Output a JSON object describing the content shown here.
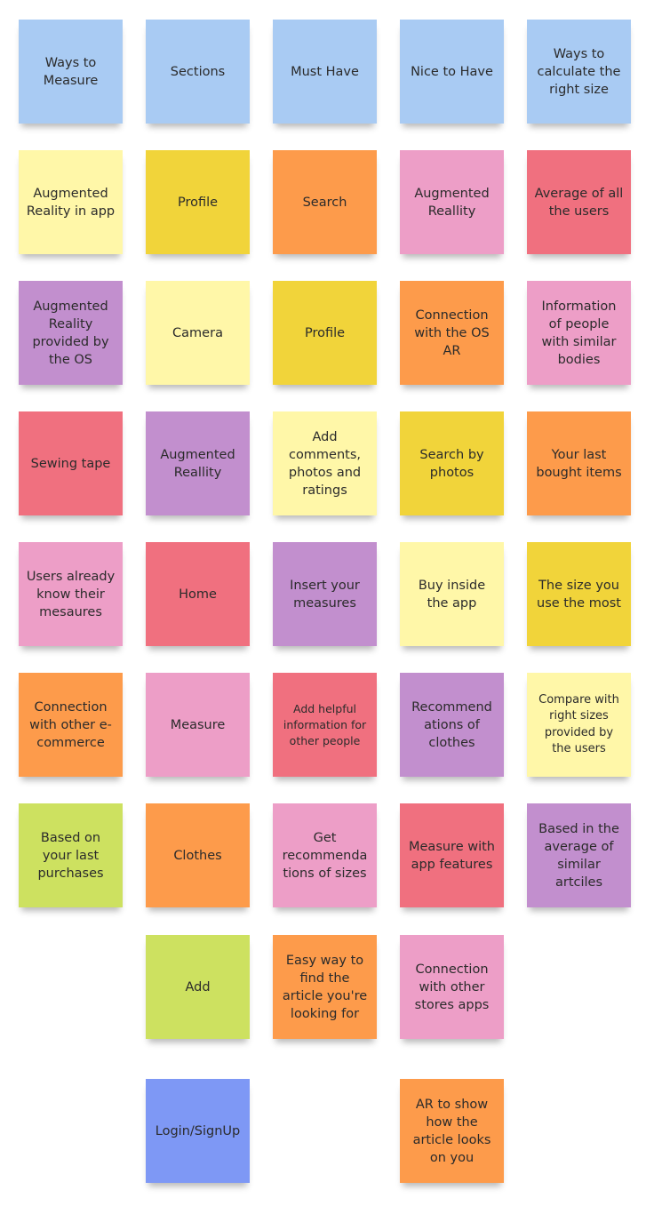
{
  "notes": [
    {
      "text": "Ways to\nMeasure",
      "color": "#a9cbf3"
    },
    {
      "text": "Sections",
      "color": "#a9cbf3"
    },
    {
      "text": "Must Have",
      "color": "#a9cbf3"
    },
    {
      "text": "Nice to Have",
      "color": "#a9cbf3"
    },
    {
      "text": "Ways to calculate the right size",
      "color": "#a9cbf3"
    },
    {
      "text": "Augmented Reality in app",
      "color": "#fff7a8"
    },
    {
      "text": "Profile",
      "color": "#f1d43a"
    },
    {
      "text": "Search",
      "color": "#fd9b4b"
    },
    {
      "text": "Augmented Reallity",
      "color": "#ed9ec7"
    },
    {
      "text": "Average of all the users",
      "color": "#f0707f"
    },
    {
      "text": "Augmented Reality provided by the OS",
      "color": "#c28fce"
    },
    {
      "text": "Camera",
      "color": "#fff7a8"
    },
    {
      "text": "Profile",
      "color": "#f1d43a"
    },
    {
      "text": "Connection with the OS AR",
      "color": "#fd9b4b"
    },
    {
      "text": "Information of people with similar bodies",
      "color": "#ed9ec7"
    },
    {
      "text": "Sewing tape",
      "color": "#f0707f"
    },
    {
      "text": "Augmented Reallity",
      "color": "#c28fce"
    },
    {
      "text": "Add comments, photos and ratings",
      "color": "#fff7a8"
    },
    {
      "text": "Search by photos",
      "color": "#f1d43a"
    },
    {
      "text": "Your last bought items",
      "color": "#fd9b4b"
    },
    {
      "text": "Users already know their mesaures",
      "color": "#ed9ec7"
    },
    {
      "text": "Home",
      "color": "#f0707f"
    },
    {
      "text": "Insert your measures",
      "color": "#c28fce"
    },
    {
      "text": "Buy inside the app",
      "color": "#fff7a8"
    },
    {
      "text": "The size you use the most",
      "color": "#f1d43a"
    },
    {
      "text": "Connection with other e-commerce",
      "color": "#fd9b4b"
    },
    {
      "text": "Measure",
      "color": "#ed9ec7"
    },
    {
      "text": "Add helpful information for other people",
      "color": "#f0707f"
    },
    {
      "text": "Recommend ations of clothes",
      "color": "#c28fce"
    },
    {
      "text": "Compare with right sizes provided by the users",
      "color": "#fff7a8"
    },
    {
      "text": "Based on your last purchases",
      "color": "#cde160"
    },
    {
      "text": "Clothes",
      "color": "#fd9b4b"
    },
    {
      "text": "Get recommenda tions of sizes",
      "color": "#ed9ec7"
    },
    {
      "text": "Measure with app features",
      "color": "#f0707f"
    },
    {
      "text": "Based in the average of similar artciles",
      "color": "#c28fce"
    },
    {
      "text": "Add",
      "color": "#cde160"
    },
    {
      "text": "Easy way to find the article you're looking for",
      "color": "#fd9b4b"
    },
    {
      "text": "Connection with other stores apps",
      "color": "#ed9ec7"
    },
    {
      "text": "Login/SignUp",
      "color": "#7e98f5"
    },
    {
      "text": "AR to show how the article looks on you",
      "color": "#fd9b4b"
    }
  ]
}
